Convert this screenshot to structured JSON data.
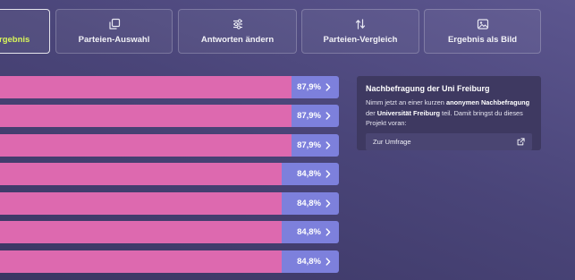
{
  "tabs": [
    {
      "label": "Ergebnis",
      "icon": "result-icon",
      "active": true
    },
    {
      "label": "Parteien-Auswahl",
      "icon": "copy-icon",
      "active": false
    },
    {
      "label": "Antworten ändern",
      "icon": "sliders-icon",
      "active": false
    },
    {
      "label": "Parteien-Vergleich",
      "icon": "compare-arrows-icon",
      "active": false
    },
    {
      "label": "Ergebnis als Bild",
      "icon": "image-icon",
      "active": false
    }
  ],
  "results": [
    {
      "value": "87,9%",
      "fraction": 0.879
    },
    {
      "value": "87,9%",
      "fraction": 0.879
    },
    {
      "value": "87,9%",
      "fraction": 0.879
    },
    {
      "value": "84,8%",
      "fraction": 0.848
    },
    {
      "value": "84,8%",
      "fraction": 0.848
    },
    {
      "value": "84,8%",
      "fraction": 0.848
    },
    {
      "value": "84,8%",
      "fraction": 0.848
    }
  ],
  "survey": {
    "title": "Nachbefragung der Uni Freiburg",
    "text_1": "Nimm jetzt an einer kurzen ",
    "text_2": "anonymen Nachbefragung",
    "text_3": " der ",
    "text_4": "Universität Freiburg",
    "text_5": " teil. Damit bringst du dieses Projekt voran:",
    "link_label": "Zur Umfrage",
    "link_icon": "external-link-icon"
  },
  "colors": {
    "bar_fill": "#dd69af",
    "bar_rest": "#7d80dc",
    "active_tab_text": "#d8f55a",
    "survey_bg": "#3e3961"
  }
}
